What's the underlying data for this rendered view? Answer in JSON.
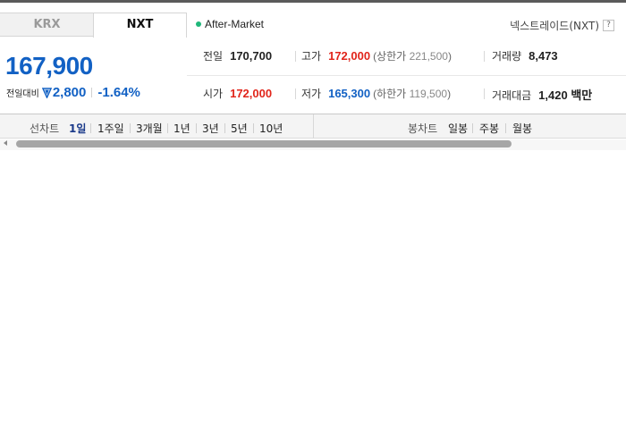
{
  "tabs": [
    {
      "label": "KRX",
      "selected": false
    },
    {
      "label": "NXT",
      "selected": true
    }
  ],
  "market_status": "After-Market",
  "exchange_name": "넥스트레이드(NXT)",
  "help_icon_glyph": "?",
  "price": {
    "current": "167,900",
    "change_label": "전일대비",
    "change_icon": "down-triangle-icon",
    "change_value": "2,800",
    "change_rate": "-1.64%"
  },
  "stats": {
    "prev_close": {
      "label": "전일",
      "value": "170,700"
    },
    "high": {
      "label": "고가",
      "value": "172,000",
      "limit_label": "상한가",
      "limit_value": "221,500"
    },
    "volume": {
      "label": "거래량",
      "value": "8,473"
    },
    "open": {
      "label": "시가",
      "value": "172,000"
    },
    "low": {
      "label": "저가",
      "value": "165,300",
      "limit_label": "하한가",
      "limit_value": "119,500"
    },
    "amount": {
      "label": "거래대금",
      "value": "1,420 백만"
    }
  },
  "line_chart": {
    "label": "선차트",
    "periods": [
      "1일",
      "1주일",
      "3개월",
      "1년",
      "3년",
      "5년",
      "10년"
    ],
    "selected": "1일"
  },
  "candle_chart": {
    "label": "봉차트",
    "periods": [
      "일봉",
      "주봉",
      "월봉"
    ]
  },
  "colors": {
    "up": "#e1251b",
    "down": "#1261c4",
    "status_dot": "#1fb77a"
  }
}
